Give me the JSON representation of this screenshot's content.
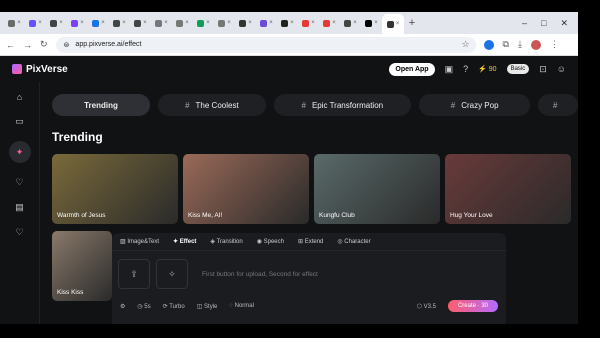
{
  "browser": {
    "tabs": [
      {
        "label": "",
        "color": "#6a6a6a"
      },
      {
        "label": "",
        "color": "#6b4cff"
      },
      {
        "label": "",
        "color": "#444"
      },
      {
        "label": "",
        "color": "#7a3fff"
      },
      {
        "label": "",
        "color": "#1a73e8"
      },
      {
        "label": "",
        "color": "#444"
      },
      {
        "label": "",
        "color": "#444"
      },
      {
        "label": "",
        "color": "#777"
      },
      {
        "label": "",
        "color": "#777"
      },
      {
        "label": "",
        "color": "#0f9d58"
      },
      {
        "label": "",
        "color": "#777"
      },
      {
        "label": "",
        "color": "#333"
      },
      {
        "label": "",
        "color": "#6c4bd8"
      },
      {
        "label": "",
        "color": "#222"
      },
      {
        "label": "",
        "color": "#e53935"
      },
      {
        "label": "",
        "color": "#e53935"
      },
      {
        "label": "",
        "color": "#444"
      },
      {
        "label": "",
        "color": "#000"
      },
      {
        "label": "",
        "color": "#333"
      }
    ],
    "url": "app.pixverse.ai/effect"
  },
  "app": {
    "logo": "PixVerse",
    "open_app": "Open App",
    "credits": "90",
    "plan": "Basic"
  },
  "chips": [
    {
      "label": "Trending",
      "hash": false
    },
    {
      "label": "The Coolest",
      "hash": true
    },
    {
      "label": "Epic Transformation",
      "hash": true
    },
    {
      "label": "Crazy Pop",
      "hash": true
    },
    {
      "label": "",
      "hash": true
    }
  ],
  "section_title": "Trending",
  "cards": [
    {
      "label": "Warmth of Jesus",
      "color": "#7a6a3a"
    },
    {
      "label": "Kiss Me, AI!",
      "color": "#9a6a58"
    },
    {
      "label": "Kungfu Club",
      "color": "#5a6a6a"
    },
    {
      "label": "Hug Your Love",
      "color": "#6a3a3a"
    }
  ],
  "card_small": {
    "label": "Kiss Kiss",
    "color": "#8a7a6a"
  },
  "panel": {
    "tabs": [
      "Image&Text",
      "Effect",
      "Transition",
      "Speech",
      "Extend",
      "Character"
    ],
    "placeholder": "First button for upload, Second for effect",
    "footer": {
      "duration": "5s",
      "model": "Turbo",
      "style": "Style",
      "mode": "Normal",
      "version": "V3.5",
      "create": "Create",
      "create_cost": "30"
    }
  }
}
